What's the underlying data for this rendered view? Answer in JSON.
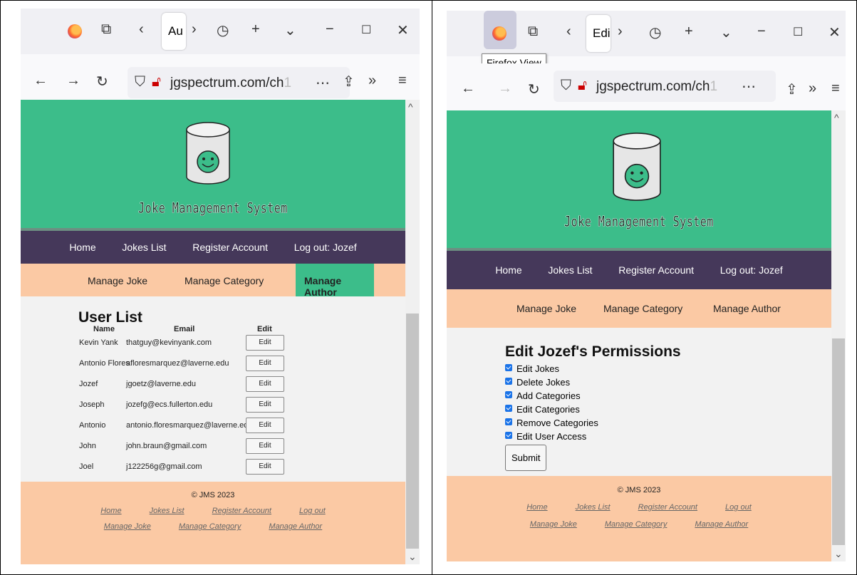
{
  "left": {
    "tab_title": "Au",
    "url_main": "jgspectrum.com/ch",
    "url_fade": "1",
    "site_title": "Joke Management System",
    "nav": [
      "Home",
      "Jokes List",
      "Register Account",
      "Log out: Jozef"
    ],
    "subnav": [
      "Manage Joke",
      "Manage Category",
      "Manage Author"
    ],
    "page_heading": "User List",
    "columns": [
      "Name",
      "Email",
      "Edit"
    ],
    "users": [
      {
        "name": "Kevin Yank",
        "email": "thatguy@kevinyank.com",
        "edit": "Edit"
      },
      {
        "name": "Antonio Flores",
        "email": "afloresmarquez@laverne.edu",
        "edit": "Edit"
      },
      {
        "name": "Jozef",
        "email": "jgoetz@laverne.edu",
        "edit": "Edit"
      },
      {
        "name": "Joseph",
        "email": "jozefg@ecs.fullerton.edu",
        "edit": "Edit"
      },
      {
        "name": "Antonio",
        "email": "antonio.floresmarquez@laverne.edu",
        "edit": "Edit"
      },
      {
        "name": "John",
        "email": "john.braun@gmail.com",
        "edit": "Edit"
      },
      {
        "name": "Joel",
        "email": "j122256g@gmail.com",
        "edit": "Edit"
      }
    ],
    "footer_copy": "© JMS 2023",
    "footer_links_1": [
      "Home",
      "Jokes List",
      "Register Account",
      "Log out"
    ],
    "footer_links_2": [
      "Manage Joke",
      "Manage Category",
      "Manage Author"
    ]
  },
  "right": {
    "tab_title": "Edi",
    "tooltip": "Firefox View",
    "url_main": "jgspectrum.com/ch",
    "url_fade": "1",
    "site_title": "Joke Management System",
    "nav": [
      "Home",
      "Jokes List",
      "Register Account",
      "Log out: Jozef"
    ],
    "subnav": [
      "Manage Joke",
      "Manage Category",
      "Manage Author"
    ],
    "page_heading": "Edit Jozef's Permissions",
    "permissions": [
      "Edit Jokes",
      "Delete Jokes",
      "Add Categories",
      "Edit Categories",
      "Remove Categories",
      "Edit User Access"
    ],
    "submit_label": "Submit",
    "footer_copy": "© JMS 2023",
    "footer_links_1": [
      "Home",
      "Jokes List",
      "Register Account",
      "Log out"
    ],
    "footer_links_2": [
      "Manage Joke",
      "Manage Category",
      "Manage Author"
    ]
  },
  "colors": {
    "header_green": "#3cbd8a",
    "nav_purple": "#45385a",
    "subnav_peach": "#fbc9a4",
    "content_gray": "#f2f2f2"
  }
}
